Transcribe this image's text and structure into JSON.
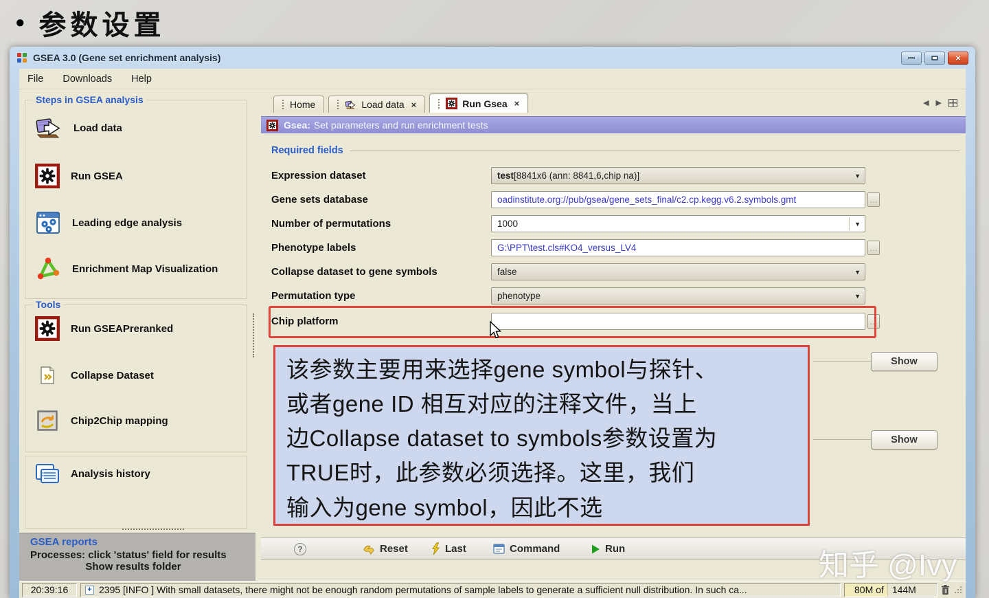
{
  "slide": {
    "bullet": "●",
    "title": "参数设置"
  },
  "window": {
    "title": "GSEA 3.0 (Gene set enrichment analysis)",
    "menu": [
      "File",
      "Downloads",
      "Help"
    ]
  },
  "sidebar": {
    "steps_title": "Steps in GSEA analysis",
    "steps": [
      {
        "label": "Load data",
        "icon": "load-data-icon"
      },
      {
        "label": "Run GSEA",
        "icon": "gear-icon"
      },
      {
        "label": "Leading edge analysis",
        "icon": "leading-edge-icon"
      },
      {
        "label": "Enrichment Map Visualization",
        "icon": "enrichment-map-icon"
      }
    ],
    "tools_title": "Tools",
    "tools": [
      {
        "label": "Run GSEAPreranked",
        "icon": "gear-icon"
      },
      {
        "label": "Collapse Dataset",
        "icon": "document-icon"
      },
      {
        "label": "Chip2Chip mapping",
        "icon": "chip2chip-icon"
      }
    ],
    "history_label": "Analysis history",
    "reports_title": "GSEA reports",
    "reports_line1": "Processes: click 'status' field for results",
    "reports_line2": "Show results folder"
  },
  "tabs": [
    {
      "label": "Home"
    },
    {
      "label": "Load data"
    },
    {
      "label": "Run Gsea"
    }
  ],
  "panel": {
    "header_prefix": "Gsea:",
    "header_rest": "Set parameters and run enrichment tests",
    "section_title": "Required fields",
    "fields": [
      {
        "label": "Expression dataset",
        "value_bold": "test",
        "value_rest": " [8841x6 (ann: 8841,6,chip na)]"
      },
      {
        "label": "Gene sets database",
        "value": "oadinstitute.org://pub/gsea/gene_sets_final/c2.cp.kegg.v6.2.symbols.gmt"
      },
      {
        "label": "Number of permutations",
        "value": "1000"
      },
      {
        "label": "Phenotype labels",
        "value": "G:\\PPT\\test.cls#KO4_versus_LV4"
      },
      {
        "label": "Collapse dataset to gene symbols",
        "value": "false"
      },
      {
        "label": "Permutation type",
        "value": "phenotype"
      },
      {
        "label": "Chip platform",
        "value": ""
      }
    ],
    "annotation": "该参数主要用来选择gene symbol与探针、\n或者gene ID 相互对应的注释文件，当上\n边Collapse dataset to symbols参数设置为\nTRUE时，此参数必须选择。这里，我们\n输入为gene symbol，因此不选",
    "show_label": "Show",
    "toolbar": {
      "reset": "Reset",
      "last": "Last",
      "command": "Command",
      "run": "Run"
    }
  },
  "statusbar": {
    "time": "20:39:16",
    "message": "2395 [INFO ] With small datasets, there might not be enough random permutations of sample labels to generate a sufficient null distribution. In such ca...",
    "memory_used": "80M of",
    "memory_total": "144M"
  },
  "watermark": "知乎 @Ivy",
  "glyphs": {
    "close": "×",
    "dropdown": "▼",
    "ellipsis": "…",
    "help": "?",
    "nav_left": "◀",
    "nav_right": "▶"
  },
  "colors": {
    "accent_red": "#e0453b",
    "annotation_bg": "#cdd7ed",
    "header_purple": "#9595d8",
    "link_blue": "#3a3ace",
    "title_blue": "#2a5cc8"
  }
}
